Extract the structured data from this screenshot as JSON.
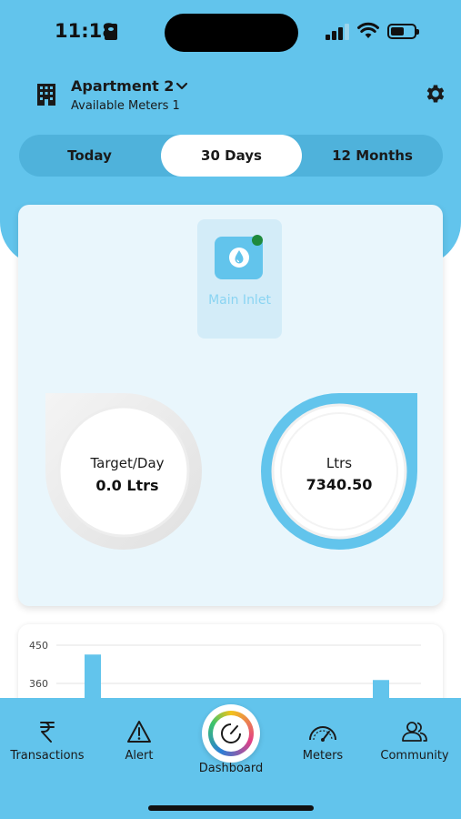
{
  "status": {
    "time": "11:18"
  },
  "header": {
    "apartment": "Apartment 2",
    "available_meters": "Available Meters 1"
  },
  "tabs": [
    {
      "label": "Today",
      "active": false
    },
    {
      "label": "30 Days",
      "active": true
    },
    {
      "label": "12 Months",
      "active": false
    }
  ],
  "meter": {
    "name": "Main Inlet",
    "status_color": "#1e8a3c"
  },
  "gauges": {
    "target": {
      "label": "Target/Day",
      "value": "0.0 Ltrs"
    },
    "usage": {
      "label": "Ltrs",
      "value": "7340.50"
    }
  },
  "chart_data": {
    "type": "bar",
    "y_ticks": [
      "450",
      "360"
    ],
    "y_tick_values": [
      450,
      360
    ],
    "ylim": [
      270,
      450
    ],
    "values": [
      428,
      368
    ],
    "categories": [
      "",
      ""
    ]
  },
  "nav": {
    "items": [
      {
        "label": "Transactions",
        "icon": "rupee-icon"
      },
      {
        "label": "Alert",
        "icon": "alert-icon"
      },
      {
        "label": "Dashboard",
        "icon": "dashboard-icon"
      },
      {
        "label": "Meters",
        "icon": "speedometer-icon"
      },
      {
        "label": "Community",
        "icon": "community-icon"
      }
    ]
  },
  "colors": {
    "brand": "#62c4ec",
    "tab_track": "#4fb2db",
    "card_bg": "#e9f6fc"
  }
}
